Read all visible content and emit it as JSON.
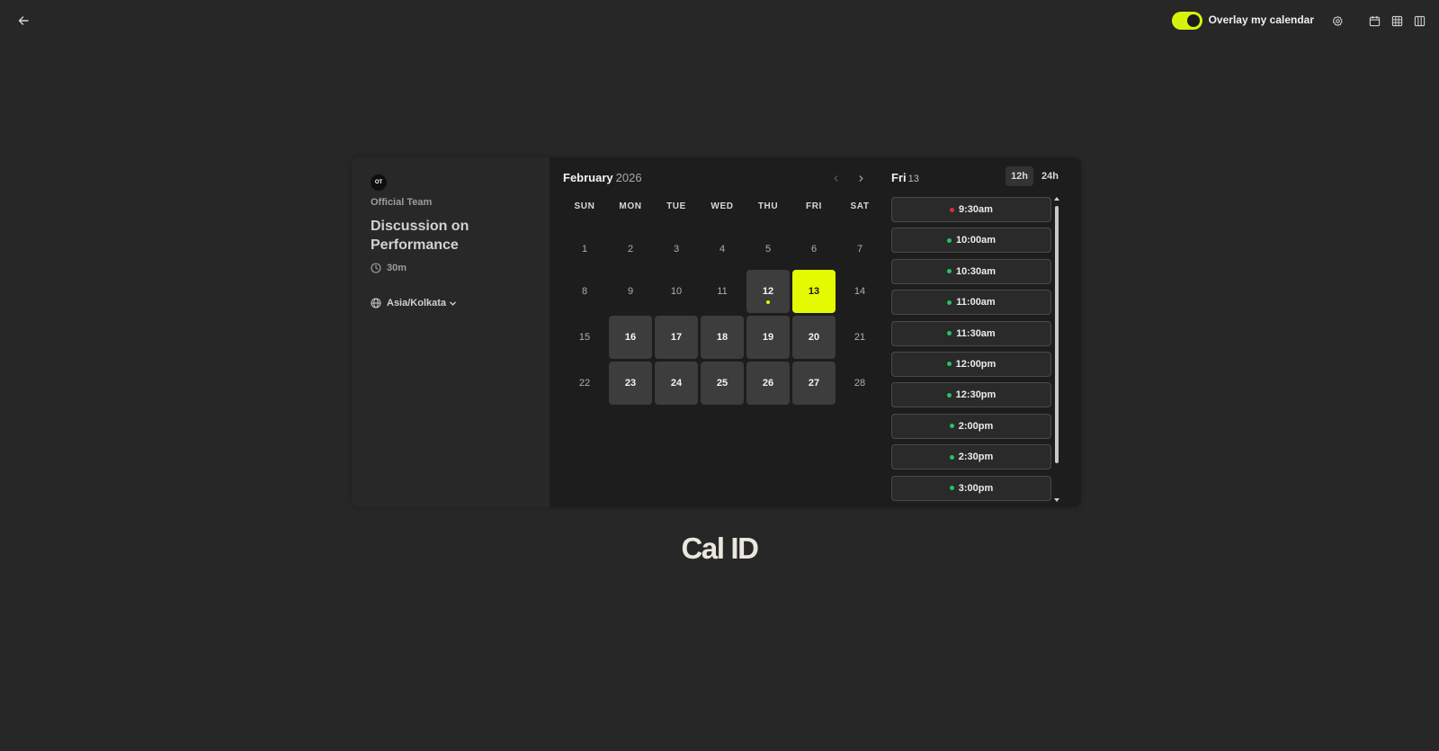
{
  "topbar": {
    "overlay_label": "Overlay my calendar",
    "overlay_enabled": true,
    "accent_color": "#d7f20a"
  },
  "event": {
    "avatar_initials": "OT",
    "team_name": "Official Team",
    "title": "Discussion on Performance",
    "duration": "30m",
    "timezone": "Asia/Kolkata"
  },
  "calendar": {
    "month": "February",
    "year": "2026",
    "weekdays": [
      "SUN",
      "MON",
      "TUE",
      "WED",
      "THU",
      "FRI",
      "SAT"
    ],
    "weeks": [
      [
        {
          "d": "1"
        },
        {
          "d": "2"
        },
        {
          "d": "3"
        },
        {
          "d": "4"
        },
        {
          "d": "5"
        },
        {
          "d": "6"
        },
        {
          "d": "7"
        }
      ],
      [
        {
          "d": "8"
        },
        {
          "d": "9"
        },
        {
          "d": "10"
        },
        {
          "d": "11"
        },
        {
          "d": "12",
          "state": "avail",
          "today": true
        },
        {
          "d": "13",
          "state": "selected"
        },
        {
          "d": "14"
        }
      ],
      [
        {
          "d": "15"
        },
        {
          "d": "16",
          "state": "avail"
        },
        {
          "d": "17",
          "state": "avail"
        },
        {
          "d": "18",
          "state": "avail"
        },
        {
          "d": "19",
          "state": "avail"
        },
        {
          "d": "20",
          "state": "avail"
        },
        {
          "d": "21"
        }
      ],
      [
        {
          "d": "22"
        },
        {
          "d": "23",
          "state": "avail"
        },
        {
          "d": "24",
          "state": "avail"
        },
        {
          "d": "25",
          "state": "avail"
        },
        {
          "d": "26",
          "state": "avail"
        },
        {
          "d": "27",
          "state": "avail"
        },
        {
          "d": "28"
        }
      ]
    ]
  },
  "slots": {
    "day_name": "Fri",
    "day_num": "13",
    "format_12h": "12h",
    "format_24h": "24h",
    "active_format": "12h",
    "items": [
      {
        "time": "9:30am",
        "status": "busy"
      },
      {
        "time": "10:00am",
        "status": "free"
      },
      {
        "time": "10:30am",
        "status": "free"
      },
      {
        "time": "11:00am",
        "status": "free"
      },
      {
        "time": "11:30am",
        "status": "free"
      },
      {
        "time": "12:00pm",
        "status": "free"
      },
      {
        "time": "12:30pm",
        "status": "free"
      },
      {
        "time": "2:00pm",
        "status": "free"
      },
      {
        "time": "2:30pm",
        "status": "free"
      },
      {
        "time": "3:00pm",
        "status": "free"
      }
    ],
    "status_colors": {
      "busy": "#e02a4a",
      "free": "#22c55e"
    }
  },
  "brand": "Cal ID"
}
